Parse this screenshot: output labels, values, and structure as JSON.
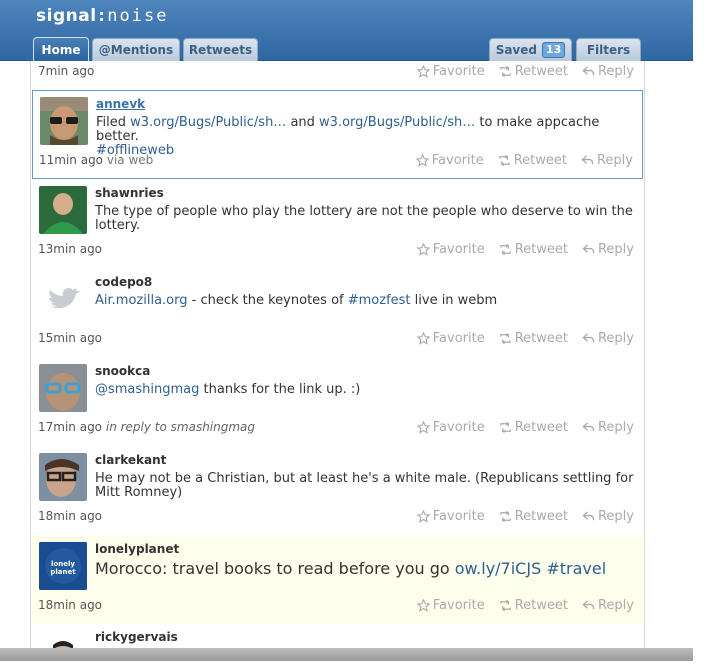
{
  "app": {
    "logo_signal": "signal",
    "logo_colon": ":",
    "logo_noise": "noise"
  },
  "tabs": {
    "home": "Home",
    "mentions": "@Mentions",
    "retweets": "Retweets",
    "saved": "Saved",
    "saved_count": "13",
    "filters": "Filters"
  },
  "actions": {
    "favorite": "Favorite",
    "retweet": "Retweet",
    "reply": "Reply"
  },
  "tweets": [
    {
      "time": "7min ago"
    },
    {
      "user": "annevk",
      "t1": "Filed ",
      "l1": "w3.org/Bugs/Public/sh…",
      "t2": " and ",
      "l2": "w3.org/Bugs/Public/sh…",
      "t3": " to make appcache better.",
      "hash": "#offlineweb",
      "time": "11min ago",
      "via": "via web"
    },
    {
      "user": "shawnries",
      "text": "The type of people who play the lottery are not the people who deserve to win the lottery.",
      "time": "13min ago"
    },
    {
      "user": "codepo8",
      "link": "Air.mozilla.org",
      "t1": " - check the keynotes of ",
      "hash": "#mozfest",
      "t2": " live in webm",
      "time": "15min ago"
    },
    {
      "user": "snookca",
      "mention": "@smashingmag",
      "t1": " thanks for the link up. :)",
      "time": "17min ago",
      "irt": "in reply to smashingmag"
    },
    {
      "user": "clarkekant",
      "text": "He may not be a Christian, but at least he's a white male. (Republicans settling for Mitt Romney)",
      "time": "18min ago"
    },
    {
      "user": "lonelyplanet",
      "t1": "Morocco: travel books to read before you go ",
      "link": "ow.ly/7iCJS",
      "hash": "#travel",
      "time": "18min ago",
      "avatar_text": "lonely planet"
    },
    {
      "user": "rickygervais"
    }
  ],
  "colors": {
    "header": "#3a72ad",
    "highlight": "#ffffee",
    "link": "#2f5f8f",
    "hashtag": "#7a2c4a"
  }
}
